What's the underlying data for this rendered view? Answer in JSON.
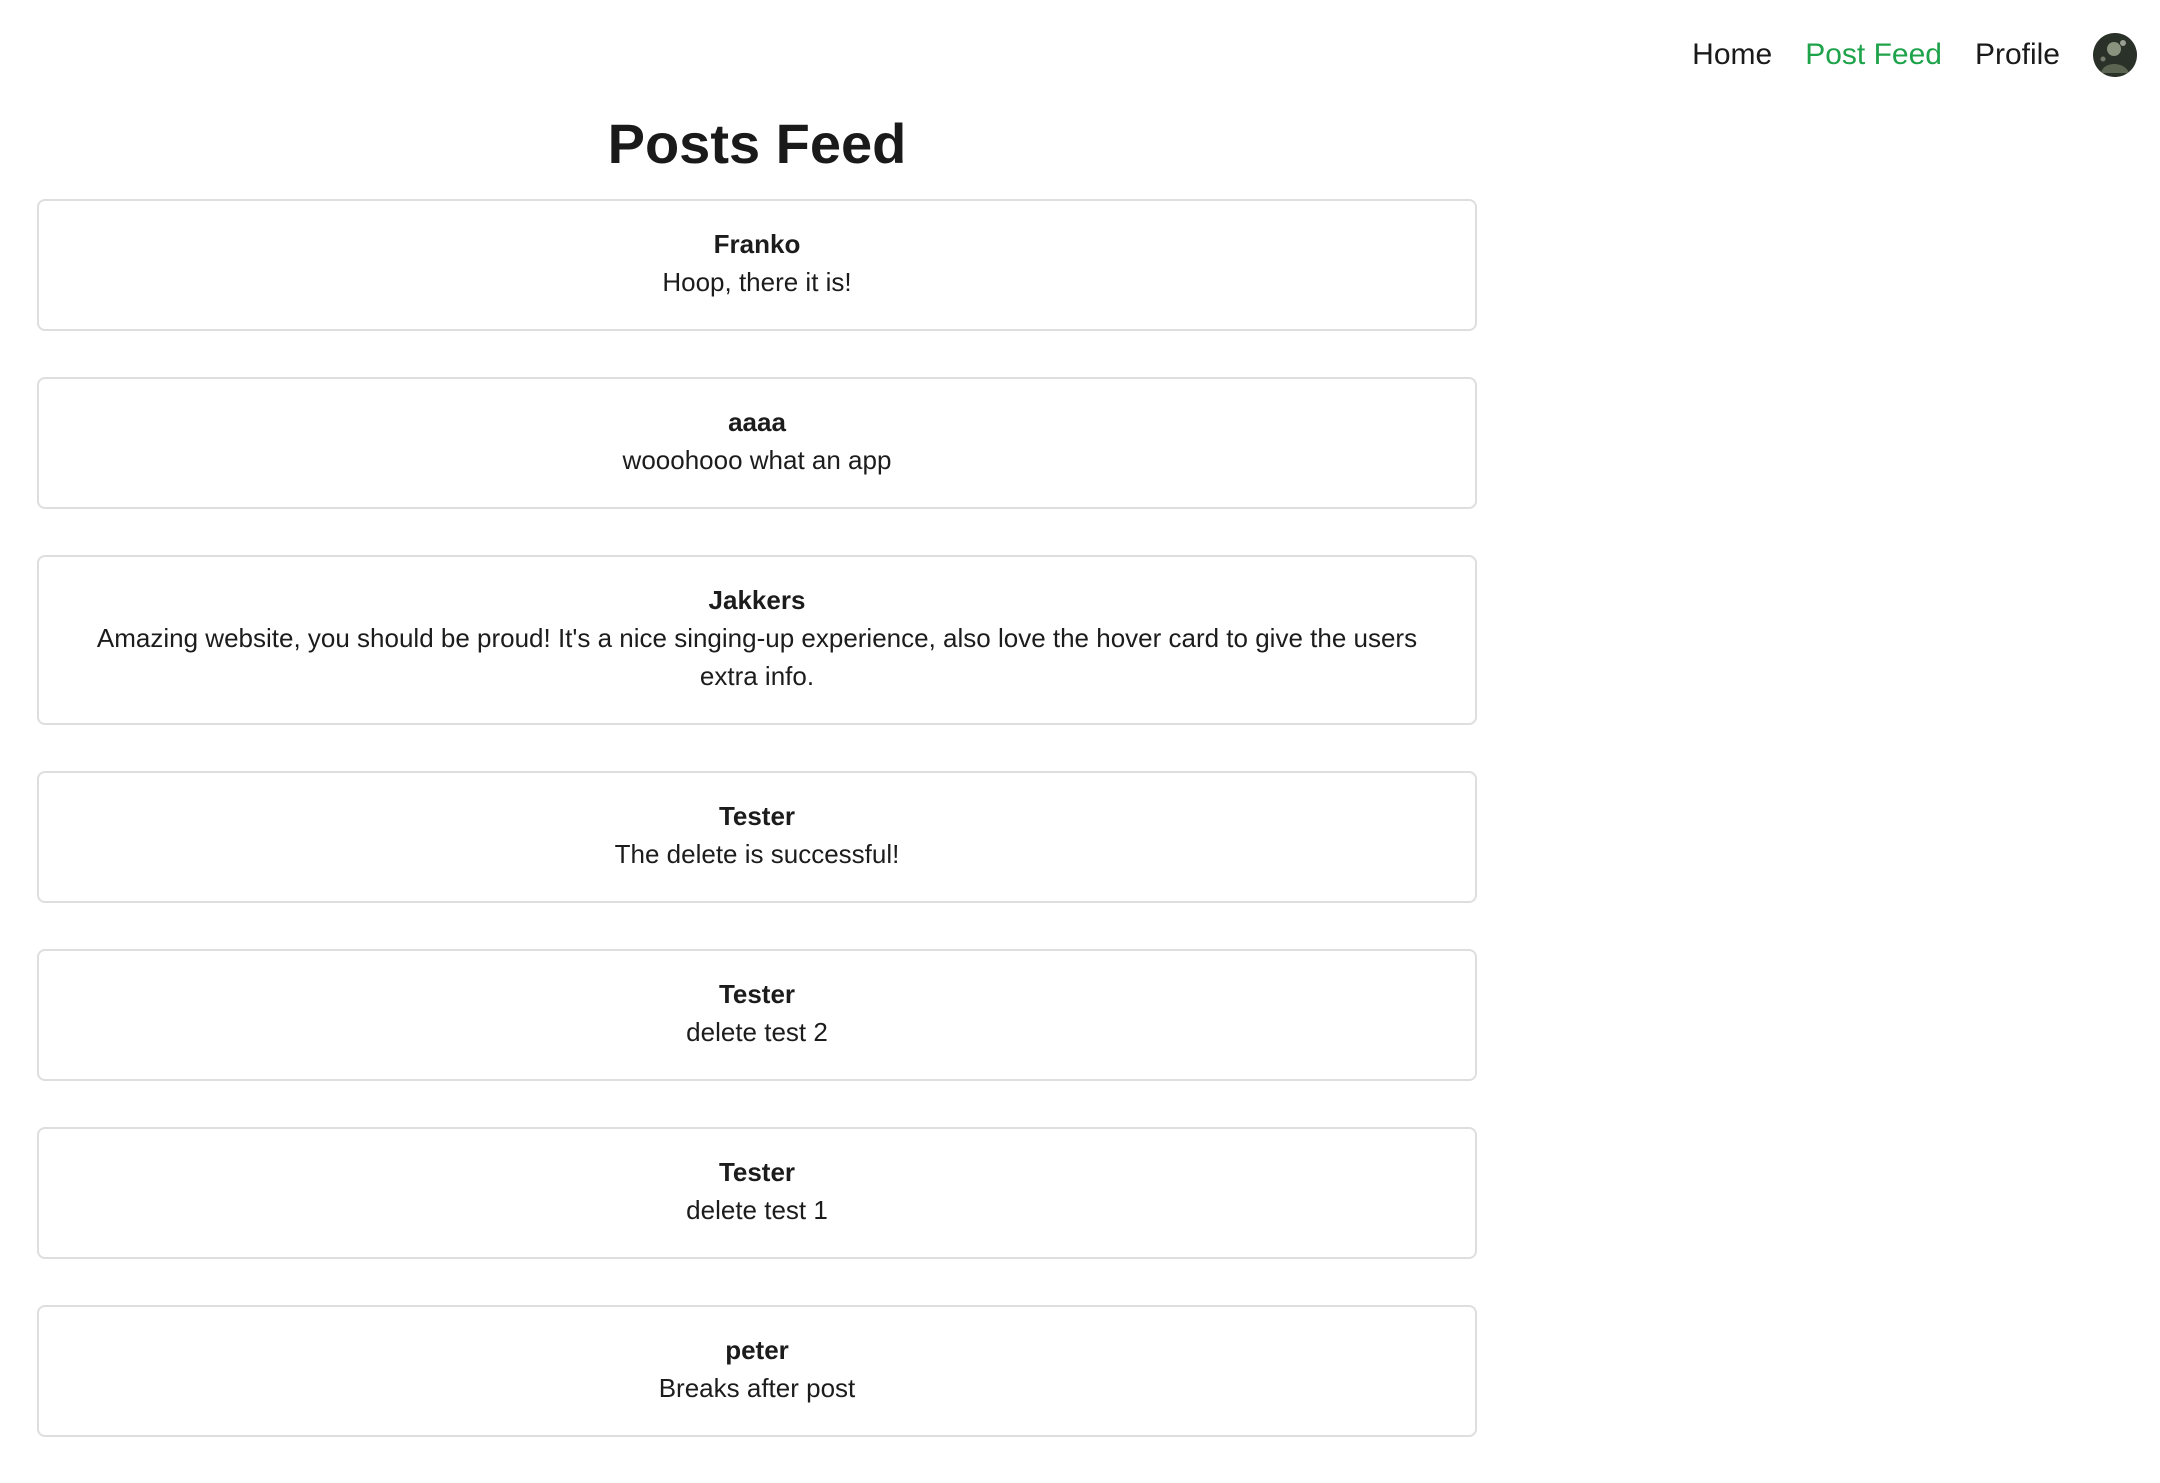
{
  "nav": {
    "links": [
      {
        "label": "Home",
        "active": false
      },
      {
        "label": "Post Feed",
        "active": true
      },
      {
        "label": "Profile",
        "active": false
      }
    ],
    "avatar_icon": "user-avatar-icon",
    "active_color": "#1fa34a"
  },
  "page": {
    "title": "Posts Feed"
  },
  "posts": [
    {
      "author": "Franko",
      "content": "Hoop, there it is!"
    },
    {
      "author": "aaaa",
      "content": "wooohooo what an app"
    },
    {
      "author": "Jakkers",
      "content": "Amazing website, you should be proud! It's a nice singing-up experience, also love the hover card to give the users extra info."
    },
    {
      "author": "Tester",
      "content": "The delete is successful!"
    },
    {
      "author": "Tester",
      "content": "delete test 2"
    },
    {
      "author": "Tester",
      "content": "delete test 1"
    },
    {
      "author": "peter",
      "content": "Breaks after post"
    }
  ]
}
